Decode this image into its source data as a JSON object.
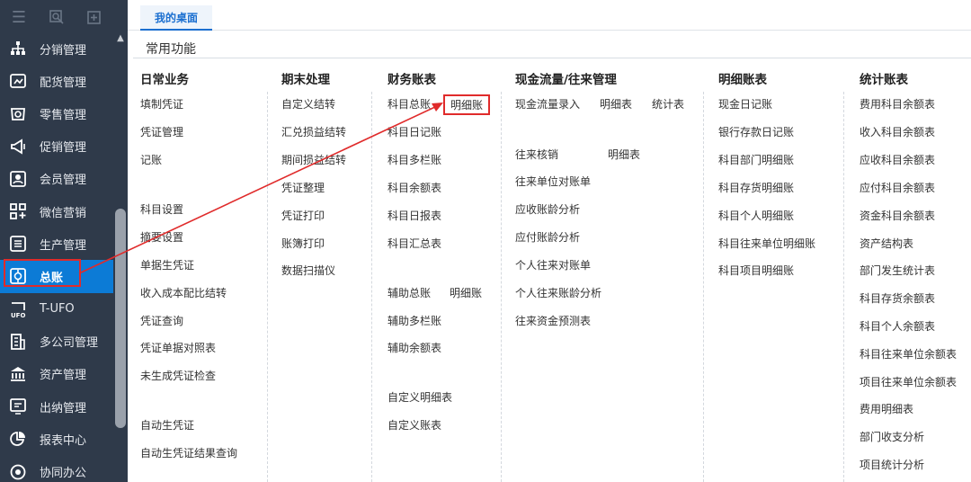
{
  "sidebar": {
    "top_icons": [
      "menu-icon",
      "search-icon",
      "new-window-icon"
    ],
    "items": [
      {
        "label": "分销管理",
        "icon": "org-tree-icon"
      },
      {
        "label": "配货管理",
        "icon": "delivery-icon"
      },
      {
        "label": "零售管理",
        "icon": "store-icon"
      },
      {
        "label": "促销管理",
        "icon": "megaphone-icon"
      },
      {
        "label": "会员管理",
        "icon": "member-card-icon"
      },
      {
        "label": "微信营销",
        "icon": "apps-icon"
      },
      {
        "label": "生产管理",
        "icon": "production-icon"
      },
      {
        "label": "总账",
        "icon": "ledger-icon"
      },
      {
        "label": "T-UFO",
        "icon": "ufo-report-icon"
      },
      {
        "label": "多公司管理",
        "icon": "building-icon"
      },
      {
        "label": "资产管理",
        "icon": "bank-icon"
      },
      {
        "label": "出纳管理",
        "icon": "cashier-icon"
      },
      {
        "label": "报表中心",
        "icon": "pie-chart-icon"
      },
      {
        "label": "协同办公",
        "icon": "collab-icon"
      }
    ],
    "active_index": 7
  },
  "tabs": {
    "home": "我的桌面"
  },
  "section": {
    "title": "常用功能"
  },
  "columns": [
    {
      "title": "日常业务",
      "links": [
        "填制凭证",
        "凭证管理",
        "记账",
        "科目设置",
        "摘要设置",
        "单据生凭证",
        "收入成本配比结转",
        "凭证查询",
        "凭证单据对照表",
        "未生成凭证检查",
        "自动生凭证",
        "自动生凭证结果查询"
      ]
    },
    {
      "title": "期末处理",
      "links": [
        "自定义结转",
        "汇兑损益结转",
        "期间损益结转",
        "凭证整理",
        "凭证打印",
        "账簿打印",
        "数据扫描仪"
      ]
    },
    {
      "title": "财务账表",
      "links": [
        "科目总账",
        "明细账",
        "科目日记账",
        "科目多栏账",
        "科目余额表",
        "科目日报表",
        "科目汇总表",
        "辅助总账",
        "明细账",
        "辅助多栏账",
        "辅助余额表",
        "自定义明细表",
        "自定义账表"
      ]
    },
    {
      "title": "现金流量/往来管理",
      "links": [
        "现金流量录入",
        "明细表",
        "统计表",
        "往来核销",
        "明细表",
        "往来单位对账单",
        "应收账龄分析",
        "应付账龄分析",
        "个人往来对账单",
        "个人往来账龄分析",
        "往来资金预测表"
      ]
    },
    {
      "title": "明细账表",
      "links": [
        "现金日记账",
        "银行存款日记账",
        "科目部门明细账",
        "科目存货明细账",
        "科目个人明细账",
        "科目往来单位明细账",
        "科目项目明细账"
      ]
    },
    {
      "title": "统计账表",
      "links": [
        "费用科目余额表",
        "收入科目余额表",
        "应收科目余额表",
        "应付科目余额表",
        "资金科目余额表",
        "资产结构表",
        "部门发生统计表",
        "科目存货余额表",
        "科目个人余额表",
        "科目往来单位余额表",
        "项目往来单位余额表",
        "费用明细表",
        "部门收支分析",
        "项目统计分析"
      ]
    }
  ],
  "colors": {
    "sidebar_bg": "#2f3a4a",
    "active_bg": "#0c7bd6",
    "highlight_red": "#e02b2b",
    "tab_blue": "#1b6fd0"
  }
}
